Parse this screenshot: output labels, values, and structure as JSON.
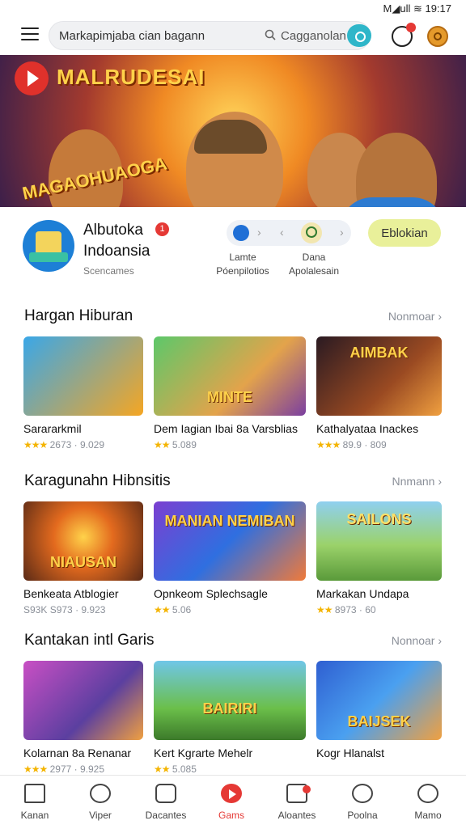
{
  "status": {
    "text": "M◢ull ≋ 19:17"
  },
  "header": {
    "search_query": "Markapimjaba cian bagann",
    "search_secondary": "Cagganolan",
    "icons": [
      "menu-icon",
      "search-pill-icon",
      "notification-icon",
      "coin-icon"
    ]
  },
  "banner": {
    "title": "MALRUDESAI",
    "subtitle": "MAGAOHUAOGA"
  },
  "app": {
    "name": "Albutoka",
    "badge": "1",
    "region": "Indoansia",
    "developer": "Scencames",
    "segment_labels": [
      {
        "line1": "Lamte",
        "line2": "Póenpilotios"
      },
      {
        "line1": "Dana",
        "line2": "Apolalesain"
      }
    ],
    "install_label": "Eblokian"
  },
  "sections": [
    {
      "title": "Hargan Hiburan",
      "more": "Nonmoar ›",
      "items": [
        {
          "title": "Sarararkmil",
          "stars": "★★★",
          "meta": "2673 · 9.029",
          "thumb_text": ""
        },
        {
          "title": "Dem Iagian Ibai 8a Varsblias",
          "stars": "★★",
          "meta": "5.089",
          "thumb_text": "MINTE"
        },
        {
          "title": "Kathalyataa Inackes",
          "stars": "★★★",
          "meta": "89.9 · 809",
          "thumb_text": "AIMBAK"
        }
      ]
    },
    {
      "title": "Karagunahn Hibnsitis",
      "more": "Nnmann ›",
      "items": [
        {
          "title": "Benkeata Atblogier",
          "stars": "S93K",
          "meta": "S973 · 9.923",
          "thumb_text": "NIAUSAN"
        },
        {
          "title": "Opnkeom Splechsagle",
          "stars": "★★",
          "meta": "5.06",
          "thumb_text": "MANIAN NEMIBAN"
        },
        {
          "title": "Markakan Undapa",
          "stars": "★★",
          "meta": "8973 · 60",
          "thumb_text": "SAILONS"
        }
      ]
    },
    {
      "title": "Kantakan intl Garis",
      "more": "Nonnoar ›",
      "items": [
        {
          "title": "Kolarnan 8a Renanar",
          "stars": "★★★",
          "meta": "2977 · 9.925",
          "thumb_text": ""
        },
        {
          "title": "Kert Kgrarte Mehelr",
          "stars": "★★",
          "meta": "5.085",
          "thumb_text": "BAIRIRI"
        },
        {
          "title": "Kogr Hlanalst",
          "stars": "",
          "meta": "",
          "thumb_text": "BAIJSEK"
        }
      ]
    }
  ],
  "bottom_nav": [
    {
      "label": "Kanan",
      "icon": "home-icon"
    },
    {
      "label": "Viper",
      "icon": "search-icon"
    },
    {
      "label": "Dacantes",
      "icon": "bag-icon"
    },
    {
      "label": "Gams",
      "icon": "play-icon",
      "active": true
    },
    {
      "label": "Aloantes",
      "icon": "apps-icon",
      "badge": true
    },
    {
      "label": "Poolna",
      "icon": "chat-icon"
    },
    {
      "label": "Mamo",
      "icon": "profile-icon"
    }
  ],
  "colors": {
    "accent": "#e53935",
    "install_bg": "#e9f09a",
    "star": "#f4b400"
  }
}
